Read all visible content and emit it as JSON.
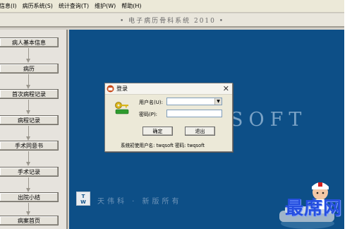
{
  "menubar": {
    "items": [
      "信息(I)",
      "病历系统(S)",
      "统计查询(T)",
      "维护(W)",
      "帮助(H)"
    ]
  },
  "app_title": "• 电子病历骨科系统 2010 •",
  "sidebar": {
    "steps": [
      "病人基本信息",
      "病历",
      "首次病程记录",
      "病程记录",
      "手术同意书",
      "手术记录",
      "出院小结",
      "病案首页"
    ]
  },
  "main": {
    "watermark": "SOFT",
    "bottom_logo_text": "T\nW",
    "bottom_text": "天伟科 · 新版所有",
    "brand": "最席网"
  },
  "login_dialog": {
    "title": "登录",
    "username_label": "用户名(U):",
    "username_value": "",
    "password_label": "密码(P):",
    "password_value": "",
    "ok_label": "确定",
    "exit_label": "退出",
    "hint": "系统初使用户名: twqsoft 密码: twqsoft"
  },
  "colors": {
    "background_blue": "#0d4f87",
    "brand_blue": "#264fe0",
    "panel_gray": "#d4d0c8"
  }
}
